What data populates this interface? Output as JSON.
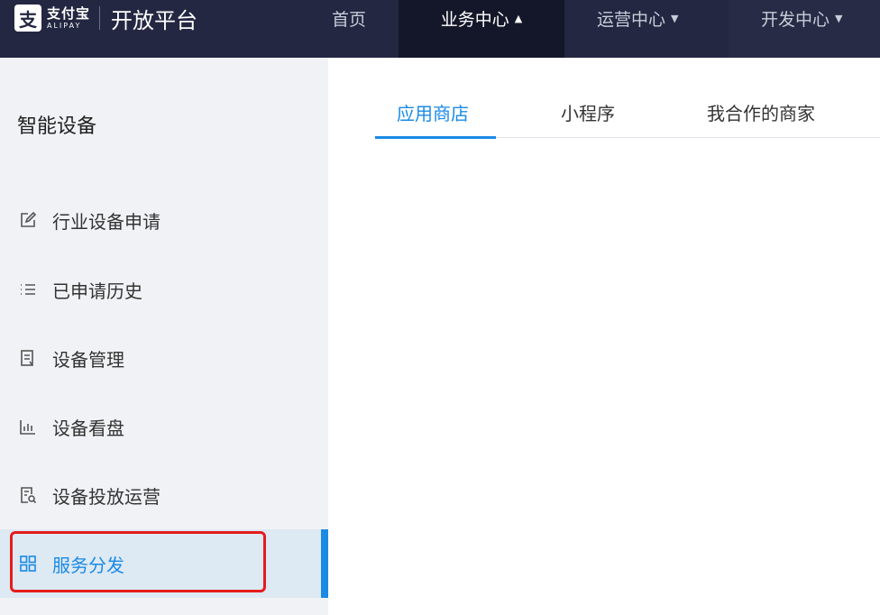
{
  "header": {
    "logo_glyph": "支",
    "brand_cn": "支付宝",
    "brand_en": "ALIPAY",
    "platform": "开放平台",
    "nav": [
      {
        "label": "首页",
        "caret": ""
      },
      {
        "label": "业务中心",
        "caret": "▲",
        "active": true
      },
      {
        "label": "运营中心",
        "caret": "▼"
      },
      {
        "label": "开发中心",
        "caret": "▼"
      }
    ]
  },
  "sidebar": {
    "title": "智能设备",
    "items": [
      {
        "label": "行业设备申请",
        "icon": "edit-icon"
      },
      {
        "label": "已申请历史",
        "icon": "list-icon"
      },
      {
        "label": "设备管理",
        "icon": "device-manage-icon"
      },
      {
        "label": "设备看盘",
        "icon": "bar-chart-icon"
      },
      {
        "label": "设备投放运营",
        "icon": "device-search-icon"
      },
      {
        "label": "服务分发",
        "icon": "grid-icon",
        "active": true
      }
    ]
  },
  "tabs": [
    {
      "label": "应用商店",
      "active": true
    },
    {
      "label": "小程序"
    },
    {
      "label": "我合作的商家"
    }
  ],
  "colors": {
    "accent": "#1a8ae5",
    "topbar": "#232741",
    "highlight": "#e51c1c"
  }
}
